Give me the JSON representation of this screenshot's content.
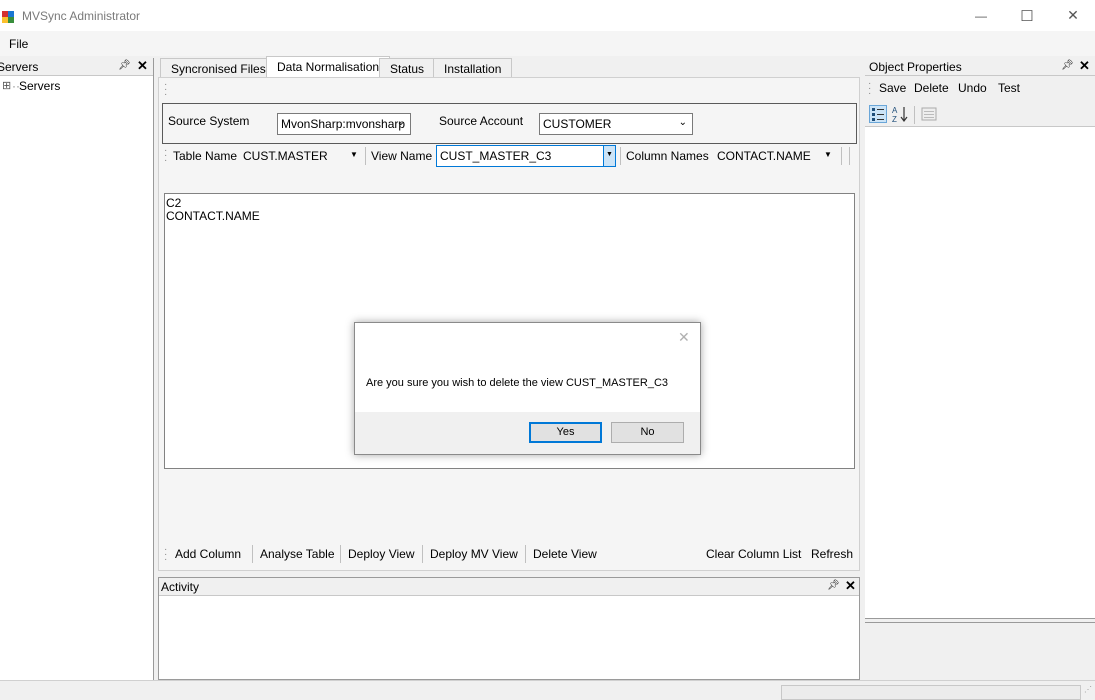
{
  "window": {
    "title": "MVSync Administrator",
    "minimize_glyph": "—",
    "maximize_glyph": "☐",
    "close_glyph": "✕"
  },
  "menu": {
    "file": "File"
  },
  "servers_panel": {
    "title": "Servers",
    "tree_root": "Servers",
    "expand_glyph": "⊞"
  },
  "tabs": [
    "Syncronised Files",
    "Data Normalisation",
    "Status",
    "Installation"
  ],
  "source": {
    "system_label": "Source System",
    "system_value": "MvonSharp:mvonsharp",
    "account_label": "Source Account",
    "account_value": "CUSTOMER"
  },
  "view_toolbar": {
    "table_label": "Table Name",
    "table_value": "CUST.MASTER",
    "view_label": "View Name",
    "view_value": "CUST_MASTER_C3",
    "columns_label": "Column Names",
    "columns_value": "CONTACT.NAME"
  },
  "text_content": {
    "line1": "C2",
    "line2": "CONTACT.NAME"
  },
  "actions": {
    "add_column": "Add Column",
    "analyse_table": "Analyse Table",
    "deploy_view": "Deploy View",
    "deploy_mv_view": "Deploy MV View",
    "delete_view": "Delete View",
    "clear_column_list": "Clear Column List",
    "refresh": "Refresh"
  },
  "dialog": {
    "message": "Are you sure you wish to delete the view CUST_MASTER_C3",
    "yes": "Yes",
    "no": "No"
  },
  "activity_panel": {
    "title": "Activity"
  },
  "object_properties": {
    "title": "Object Properties",
    "save": "Save",
    "delete": "Delete",
    "undo": "Undo",
    "test": "Test"
  },
  "colors": {
    "accent": "#0078d7",
    "window_bg": "#f0f0f0"
  }
}
